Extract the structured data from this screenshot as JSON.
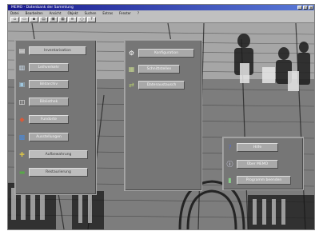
{
  "titlebar": {
    "title": "MEMO - Datenbank der Sammlung"
  },
  "menubar": {
    "items": [
      "Datei",
      "Bearbeiten",
      "Ansicht",
      "Objekt",
      "Suchen",
      "Extras",
      "Fenster",
      "?"
    ]
  },
  "toolbar": {
    "icons": [
      "new-icon",
      "open-icon",
      "save-icon",
      "print-icon",
      "copy-icon",
      "grid-icon",
      "list-icon",
      "search-icon",
      "help-icon"
    ]
  },
  "panel_left": {
    "items": [
      {
        "icon": "document-icon",
        "label": "Inventarisation"
      },
      {
        "icon": "book-icon",
        "label": "Leihverkehr"
      },
      {
        "icon": "photo-icon",
        "label": "Bildarchiv"
      },
      {
        "icon": "open-book-icon",
        "label": "Bibliothek"
      },
      {
        "icon": "car-icon",
        "label": "Fundorte"
      },
      {
        "icon": "painting-icon",
        "label": "Ausstellungen"
      },
      {
        "icon": "tools-icon",
        "label": "Aufbewahrung"
      },
      {
        "icon": "landscape-icon",
        "label": "Restaurierung"
      }
    ]
  },
  "panel_middle": {
    "items": [
      {
        "icon": "gear-icon",
        "label": "Konfiguration"
      },
      {
        "icon": "grid-window-icon",
        "label": "Schnittstellen"
      },
      {
        "icon": "arrows-icon",
        "label": "Datenaustausch"
      }
    ]
  },
  "panel_right": {
    "items": [
      {
        "icon": "question-icon",
        "label": "Hilfe"
      },
      {
        "icon": "info-icon",
        "label": "Über MEMO"
      },
      {
        "icon": "exit-door-icon",
        "label": "Programm beenden"
      }
    ]
  }
}
